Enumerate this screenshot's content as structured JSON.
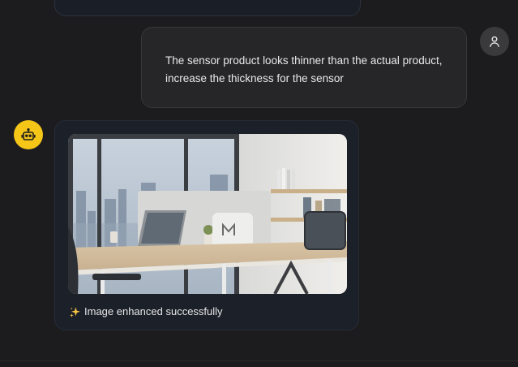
{
  "chat": {
    "user_message": {
      "text": "The sensor product looks thinner than the actual product, increase the thickness for the sensor",
      "avatar_icon": "user-icon"
    },
    "bot_message": {
      "avatar_icon": "robot-icon",
      "image_alt": "Office desk with sensor device and laptop near large windows",
      "caption_icon": "sparkles-icon",
      "caption": "Image enhanced successfully"
    }
  },
  "colors": {
    "background": "#1c1c1e",
    "user_bubble": "#262628",
    "bot_card": "#1b2029",
    "bot_avatar": "#f5c518"
  }
}
